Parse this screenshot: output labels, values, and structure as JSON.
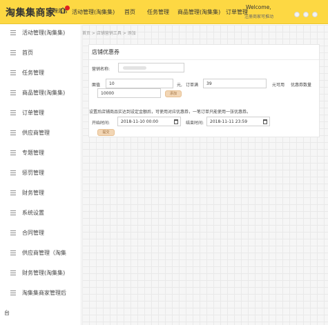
{
  "header": {
    "brand": "淘集集商家",
    "mgr_label": "管理后台",
    "nav": [
      "活动管理(淘集集)",
      "首页",
      "任务管理",
      "商品管理(淘集集)",
      "订单管理"
    ],
    "welcome": "Welcome,",
    "subtip": "注册商家可推动"
  },
  "sidebar": {
    "items": [
      "活动管理(淘集集)",
      "首页",
      "任务管理",
      "商品管理(淘集集)",
      "订单管理",
      "供应商管理",
      "专题管理",
      "惩罚管理",
      "财务管理",
      "系统设置",
      "合同管理",
      "供应商管理（淘集",
      "财务管理(淘集集)",
      "淘集集商家管理后"
    ],
    "trailing": "台"
  },
  "breadcrumb": "首页 > 店铺营销工具 > 添加",
  "form": {
    "title": "店铺优惠券",
    "name_label": "营销名称:",
    "face_label": "面值",
    "face_value": "10",
    "unit_yuan": "元,",
    "order_full_label": "订单满",
    "order_full_value": "39",
    "usable_label": "元可用",
    "qty_label": "优惠券数量",
    "qty_value": "10000",
    "add_btn": "添加",
    "tip": "设置后店铺商品实达到设定金额后，可使用对应优惠券，一笔订单只能使用一张优惠券。",
    "start_label": "开始时间:",
    "start_value": "2018-11-10 00:00",
    "end_label": "结束时间:",
    "end_value": "2018-11-11 23:59",
    "submit_btn": "提交"
  },
  "colors": {
    "header_bg": "#fdd843",
    "badge": "#e02020",
    "button_bg": "#f2d6b5"
  }
}
